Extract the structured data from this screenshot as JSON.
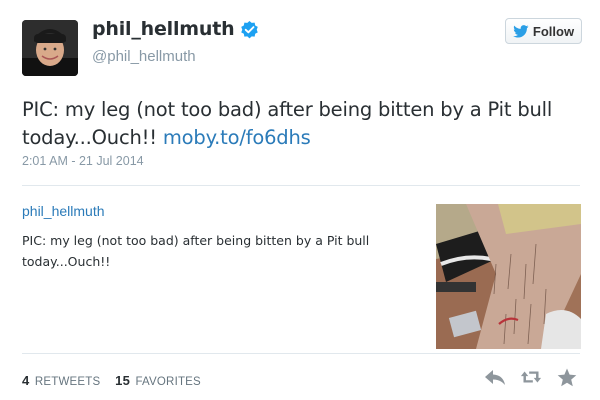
{
  "user": {
    "display_name": "phil_hellmuth",
    "handle": "@phil_hellmuth",
    "verified": true
  },
  "follow": {
    "label": "Follow"
  },
  "tweet": {
    "text_prefix": "PIC: my leg (not too bad) after being bitten by a Pit bull today...Ouch!! ",
    "link": "moby.to/fo6dhs",
    "timestamp": "2:01 AM - 21 Jul 2014"
  },
  "card": {
    "user": "phil_hellmuth",
    "text": "PIC: my leg (not too bad) after being bitten by a Pit bull today...Ouch!!"
  },
  "stats": {
    "retweets_count": "4",
    "retweets_label": "RETWEETS",
    "favorites_count": "15",
    "favorites_label": "FAVORITES"
  },
  "icons": {
    "verified": "verified-badge-icon",
    "bird": "twitter-bird-icon",
    "reply": "reply-icon",
    "retweet": "retweet-icon",
    "favorite": "star-icon"
  },
  "colors": {
    "link": "#2b7bb9",
    "verified": "#1da1f2",
    "muted": "#8899a6",
    "action_icon": "#8e969c"
  }
}
